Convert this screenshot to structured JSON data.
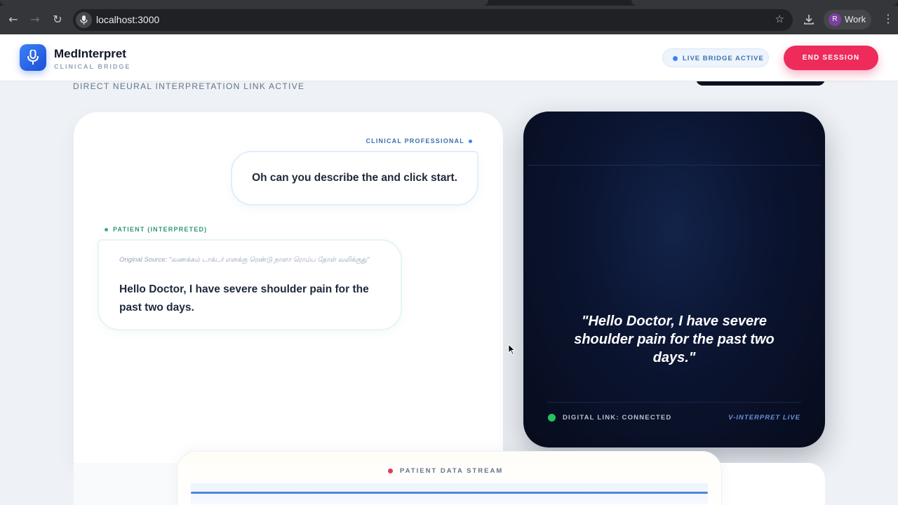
{
  "browser": {
    "url": "localhost:3000",
    "profile_initial": "R",
    "profile_name": "Work",
    "back_icon": "←",
    "forward_icon": "→",
    "reload_icon": "↻",
    "star_icon": "☆",
    "menu_icon": "⋮"
  },
  "header": {
    "brand": "MedInterpret",
    "brand_sub": "CLINICAL BRIDGE",
    "live_status": "LIVE BRIDGE ACTIVE",
    "end_session": "END SESSION"
  },
  "page": {
    "subtitle": "DIRECT NEURAL INTERPRETATION LINK ACTIVE"
  },
  "chat": {
    "clinician_label": "CLINICAL PROFESSIONAL",
    "clinician_message": "Oh can you describe the and click start.",
    "patient_label": "PATIENT (INTERPRETED)",
    "original_source": "Original Source: \"வணக்கம் டாக்டர் எனக்கு ரெண்டு நாளா ரொம்ப தோள் வலிக்குது\"",
    "patient_message": "Hello Doctor, I have severe shoulder pain for the past two days."
  },
  "video": {
    "caption": "\"Hello Doctor, I have severe shoulder pain for the past two days.\"",
    "connection_status": "DIGITAL LINK: CONNECTED",
    "brand_live": "V-INTERPRET LIVE"
  },
  "stream": {
    "label": "PATIENT DATA STREAM"
  },
  "colors": {
    "accent_blue": "#3b82f6",
    "end_button": "#ee2b5b",
    "connected_green": "#22c55e",
    "video_bg": "#0b1430"
  }
}
